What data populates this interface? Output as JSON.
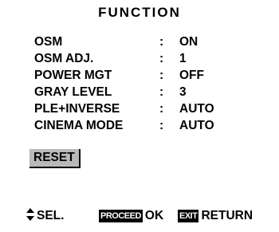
{
  "title": "FUNCTION",
  "menu": {
    "items": [
      {
        "label": "OSM",
        "colon": ":",
        "value": "ON"
      },
      {
        "label": "OSM ADJ.",
        "colon": ":",
        "value": "1"
      },
      {
        "label": "POWER MGT",
        "colon": ":",
        "value": "OFF"
      },
      {
        "label": "GRAY LEVEL",
        "colon": ":",
        "value": "3"
      },
      {
        "label": "PLE+INVERSE",
        "colon": ":",
        "value": "AUTO"
      },
      {
        "label": "CINEMA MODE",
        "colon": ":",
        "value": "AUTO"
      }
    ],
    "reset_label": "RESET"
  },
  "footer": {
    "select_icon": "up-down-arrow-icon",
    "select_label": "SEL.",
    "proceed_key": "PROCEED",
    "proceed_label": "OK",
    "exit_key": "EXIT",
    "exit_label": "RETURN"
  },
  "colors": {
    "background": "#ffffff",
    "text": "#000000",
    "reset_highlight": "#b9b9b9",
    "key_label_bg": "#000000",
    "key_label_text": "#ffffff"
  }
}
